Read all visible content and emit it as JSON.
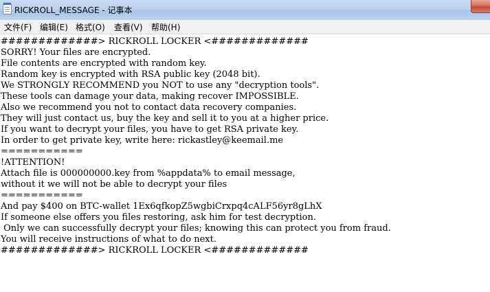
{
  "window": {
    "title": "RICKROLL_MESSAGE - 记事本"
  },
  "menu": {
    "items": [
      "文件(F)",
      "编辑(E)",
      "格式(O)",
      "查看(V)",
      "帮助(H)"
    ]
  },
  "document": {
    "lines": [
      "#############> RICKROLL LOCKER <#############",
      "SORRY! Your files are encrypted.",
      "File contents are encrypted with random key.",
      "Random key is encrypted with RSA public key (2048 bit).",
      "We STRONGLY RECOMMEND you NOT to use any \"decryption tools\".",
      "These tools can damage your data, making recover IMPOSSIBLE.",
      "Also we recommend you not to contact data recovery companies.",
      "They will just contact us, buy the key and sell it to you at a higher price.",
      "If you want to decrypt your files, you have to get RSA private key.",
      "In order to get private key, write here: rickastley@keemail.me",
      "===========",
      "!ATTENTION!",
      "Attach file is 000000000.key from %appdata% to email message,",
      "without it we will not be able to decrypt your files",
      "===========",
      "And pay $400 on BTC-wallet 1Ex6qfkopZ5wgbiCrxpq4cALF56yr8gLhX",
      "If someone else offers you files restoring, ask him for test decryption.",
      " Only we can successfully decrypt your files; knowing this can protect you from fraud.",
      "You will receive instructions of what to do next.",
      "#############> RICKROLL LOCKER <#############"
    ]
  }
}
